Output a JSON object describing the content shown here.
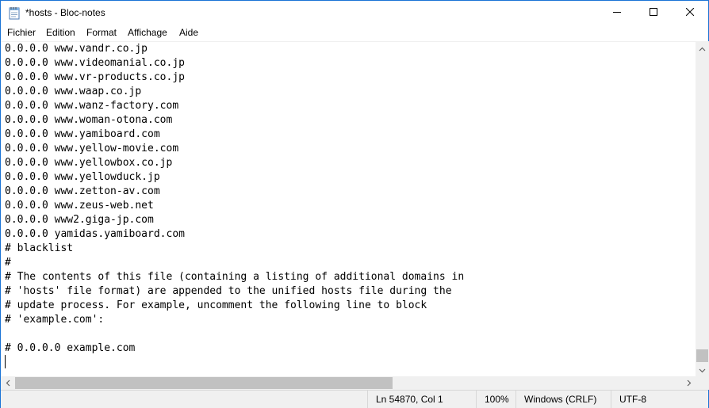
{
  "titlebar": {
    "title": "*hosts - Bloc-notes",
    "app_icon": "notepad-icon",
    "minimize_icon": "minimize-icon",
    "maximize_icon": "maximize-icon",
    "close_icon": "close-icon"
  },
  "menu": {
    "items": [
      "Fichier",
      "Edition",
      "Format",
      "Affichage",
      "Aide"
    ]
  },
  "editor": {
    "lines": [
      "0.0.0.0 www.vandr.co.jp",
      "0.0.0.0 www.videomanial.co.jp",
      "0.0.0.0 www.vr-products.co.jp",
      "0.0.0.0 www.waap.co.jp",
      "0.0.0.0 www.wanz-factory.com",
      "0.0.0.0 www.woman-otona.com",
      "0.0.0.0 www.yamiboard.com",
      "0.0.0.0 www.yellow-movie.com",
      "0.0.0.0 www.yellowbox.co.jp",
      "0.0.0.0 www.yellowduck.jp",
      "0.0.0.0 www.zetton-av.com",
      "0.0.0.0 www.zeus-web.net",
      "0.0.0.0 www2.giga-jp.com",
      "0.0.0.0 yamidas.yamiboard.com",
      "# blacklist",
      "#",
      "# The contents of this file (containing a listing of additional domains in",
      "# 'hosts' file format) are appended to the unified hosts file during the",
      "# update process. For example, uncomment the following line to block",
      "# 'example.com':",
      "",
      "# 0.0.0.0 example.com",
      ""
    ]
  },
  "statusbar": {
    "position": "Ln 54870, Col 1",
    "zoom": "100%",
    "line_ending": "Windows (CRLF)",
    "encoding": "UTF-8"
  },
  "colors": {
    "window_border": "#1a73d6",
    "statusbar_bg": "#f0f0f0",
    "scroll_thumb": "#c1c1c1"
  }
}
